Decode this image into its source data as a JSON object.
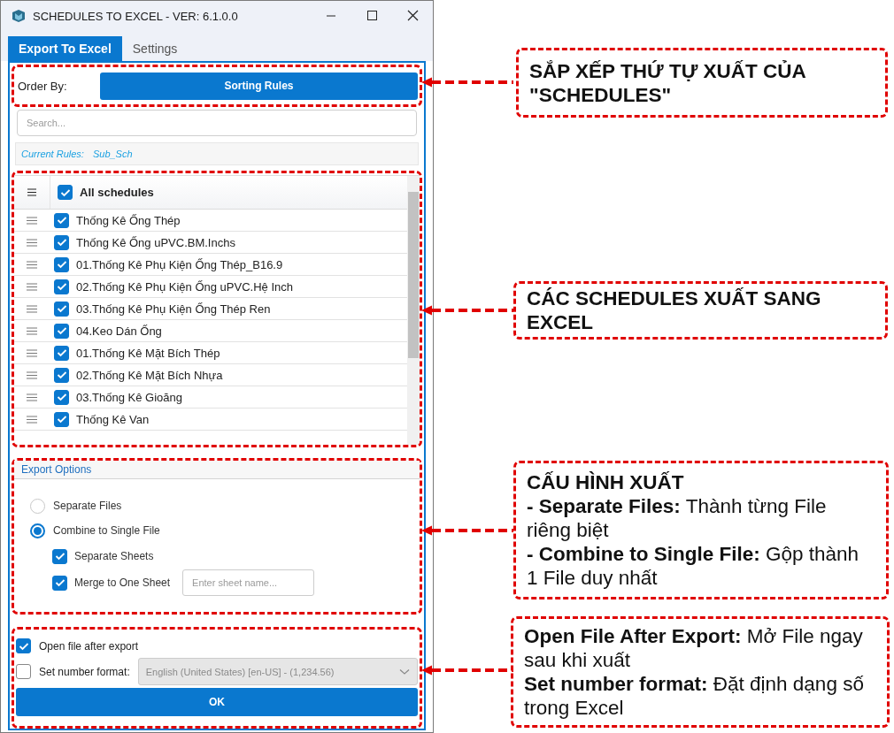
{
  "window": {
    "title": "SCHEDULES TO EXCEL - VER: 6.1.0.0"
  },
  "tabs": [
    {
      "label": "Export To Excel",
      "selected": true
    },
    {
      "label": "Settings",
      "selected": false
    }
  ],
  "order_by": {
    "label": "Order By:",
    "button": "Sorting Rules"
  },
  "search": {
    "placeholder": "Search..."
  },
  "current_rules": {
    "label": "Current Rules:",
    "value": "Sub_Sch"
  },
  "schedule_list": {
    "header": {
      "label": "All schedules",
      "checked": true
    },
    "rows": [
      {
        "label": "Thống Kê Ống Thép",
        "checked": true
      },
      {
        "label": "Thống Kê Ống uPVC.BM.Inchs",
        "checked": true
      },
      {
        "label": "01.Thống Kê Phụ Kiện Ống Thép_B16.9",
        "checked": true
      },
      {
        "label": "02.Thống Kê Phụ Kiện Ống uPVC.Hệ Inch",
        "checked": true
      },
      {
        "label": "03.Thống Kê Phụ Kiện Ống Thép Ren",
        "checked": true
      },
      {
        "label": "04.Keo Dán Ống",
        "checked": true
      },
      {
        "label": "01.Thống Kê Mặt Bích Thép",
        "checked": true
      },
      {
        "label": "02.Thống Kê Mặt Bích Nhựa",
        "checked": true
      },
      {
        "label": "03.Thống Kê Gioăng",
        "checked": true
      },
      {
        "label": "Thống Kê Van",
        "checked": true
      }
    ]
  },
  "export_options": {
    "title": "Export Options",
    "modes": [
      {
        "label": "Separate Files",
        "selected": false
      },
      {
        "label": "Combine to Single File",
        "selected": true
      }
    ],
    "sheet_options": [
      {
        "label": "Separate Sheets",
        "checked": true
      },
      {
        "label": "Merge to One Sheet",
        "checked": true
      }
    ],
    "sheet_name": {
      "placeholder": "Enter sheet name..."
    }
  },
  "open_after_export": {
    "label": "Open file after export",
    "checked": true
  },
  "number_format": {
    "label": "Set number format:",
    "checked": false,
    "value": "English (United States) [en-US] - (1,234.56)",
    "disabled": true
  },
  "ok_button": "OK",
  "callouts": [
    {
      "lines": [
        {
          "kind": "heading",
          "text": "SẮP XẾP THỨ TỰ XUẤT CỦA \"SCHEDULES\""
        }
      ]
    },
    {
      "lines": [
        {
          "kind": "heading",
          "text": "CÁC SCHEDULES XUẤT SANG EXCEL"
        }
      ]
    },
    {
      "lines": [
        {
          "kind": "heading",
          "text": "CẤU HÌNH XUẤT"
        },
        {
          "kind": "note",
          "text": "**- Separate Files:** Thành từng File riêng biệt"
        },
        {
          "kind": "note",
          "text": "**- Combine to Single File:** Gộp thành 1 File duy nhất"
        }
      ]
    },
    {
      "lines": [
        {
          "kind": "note",
          "text": "**Open File After Export:** Mở File ngay sau khi xuất"
        },
        {
          "kind": "note",
          "text": "**Set number format:** Đặt định dạng số trong Excel"
        }
      ]
    }
  ]
}
